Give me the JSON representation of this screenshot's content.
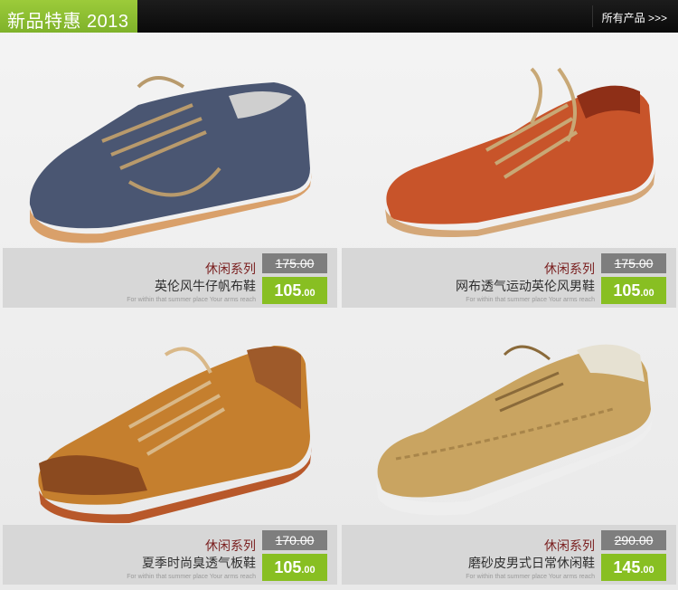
{
  "header": {
    "title": "新品特惠 2013",
    "all_products": "所有产品 >>>"
  },
  "colors": {
    "accent": "#88bf22",
    "old_price_bg": "#7e7e7e",
    "series_text": "#7a1f1f"
  },
  "products": [
    {
      "series": "休闲系列",
      "name": "英伦风牛仔帆布鞋",
      "slogan": "For within that summer place Your arms reach",
      "old_price": "175.00",
      "new_price_int": "105",
      "new_price_dec": ".00",
      "shoe_color": "navy-denim"
    },
    {
      "series": "休闲系列",
      "name": "网布透气运动英伦风男鞋",
      "slogan": "For within that summer place Your arms reach",
      "old_price": "175.00",
      "new_price_int": "105",
      "new_price_dec": ".00",
      "shoe_color": "orange"
    },
    {
      "series": "休闲系列",
      "name": "夏季时尚臭透气板鞋",
      "slogan": "For within that summer place Your arms reach",
      "old_price": "170.00",
      "new_price_int": "105",
      "new_price_dec": ".00",
      "shoe_color": "tan-brown"
    },
    {
      "series": "休闲系列",
      "name": "磨砂皮男式日常休闲鞋",
      "slogan": "For within that summer place Your arms reach",
      "old_price": "290.00",
      "new_price_int": "145",
      "new_price_dec": ".00",
      "shoe_color": "khaki-suede"
    }
  ]
}
